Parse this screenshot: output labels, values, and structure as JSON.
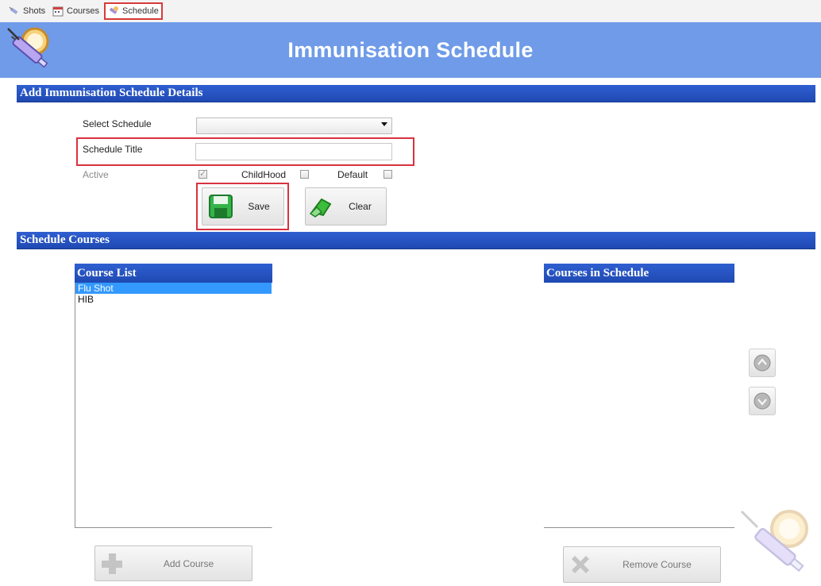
{
  "tabs": [
    {
      "label": "Shots",
      "icon": "syringe-icon"
    },
    {
      "label": "Courses",
      "icon": "calendar-icon"
    },
    {
      "label": "Schedule",
      "icon": "schedule-icon",
      "active": true
    }
  ],
  "header": {
    "title": "Immunisation Schedule",
    "logo": "syringe-logo"
  },
  "details_section": {
    "title": "Add Immunisation Schedule Details",
    "select_schedule_label": "Select Schedule",
    "select_schedule_value": "",
    "schedule_title_label": "Schedule Title",
    "schedule_title_value": "",
    "active_label": "Active",
    "active_checked": true,
    "childhood_label": "ChildHood",
    "childhood_checked": false,
    "default_label": "Default",
    "default_checked": false,
    "save_label": "Save",
    "clear_label": "Clear"
  },
  "courses_section": {
    "title": "Schedule Courses",
    "course_list_header": "Course List",
    "course_list": [
      {
        "label": "Flu Shot",
        "selected": true
      },
      {
        "label": "HIB",
        "selected": false
      }
    ],
    "courses_in_schedule_header": "Courses in Schedule",
    "courses_in_schedule": [],
    "add_course_label": "Add Course",
    "remove_course_label": "Remove Course",
    "move_up_icon": "up-arrow-icon",
    "move_down_icon": "down-arrow-icon"
  },
  "colors": {
    "banner": "#6f9be8",
    "section_bar": "#2452c3",
    "highlight_box": "#d8323f",
    "selection": "#3399ff"
  }
}
